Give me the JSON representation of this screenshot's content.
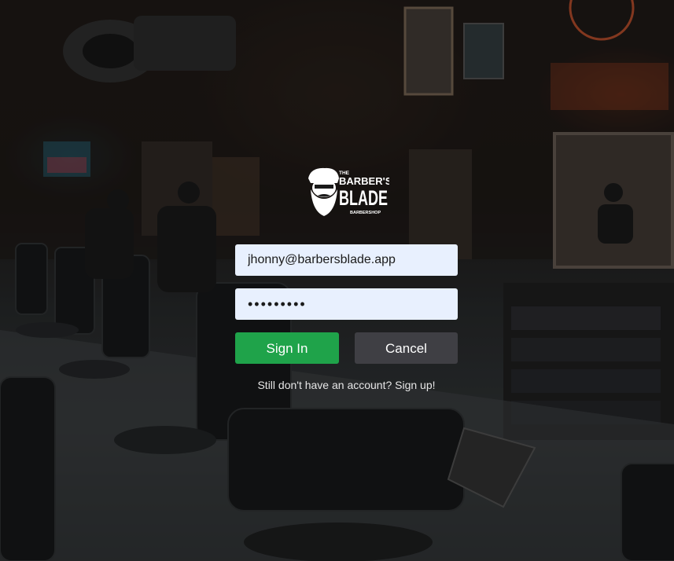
{
  "logo": {
    "line1": "THE",
    "line2": "BARBER'S",
    "line3": "BLADE",
    "line4": "BARBERSHOP"
  },
  "login": {
    "email_value": "jhonny@barbersblade.app",
    "password_value": "•••••••••",
    "signin_label": "Sign In",
    "cancel_label": "Cancel",
    "signup_text": "Still don't have an account? Sign up!"
  },
  "colors": {
    "signin_bg": "#1fa34a",
    "cancel_bg": "#3f3f44",
    "field_bg": "#e8f0fe"
  },
  "icons": {
    "logo_mark": "bearded-man-icon"
  }
}
